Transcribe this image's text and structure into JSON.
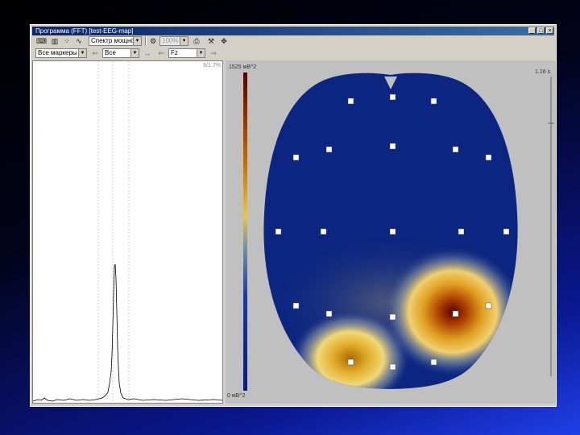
{
  "window": {
    "title": "Программа (FFT) [test-EEG-map]"
  },
  "toolbar1": {
    "mode_combo": "Спектр мощнос",
    "zoom_combo": "100%"
  },
  "toolbar2": {
    "markers_combo": "Все маркеры",
    "channel_combo": "Все",
    "band_combo": "Fz"
  },
  "trace": {
    "corner_label": "6/1.7%"
  },
  "map": {
    "scale_max_label": "1525 мВ^2",
    "scale_min_label": "0 мВ^2",
    "ruler_top_label": "1.16 s",
    "colors": {
      "background": "#c0c0c0",
      "low": "#0b2580",
      "mid": "#e8c85a",
      "high": "#5c0000"
    }
  }
}
